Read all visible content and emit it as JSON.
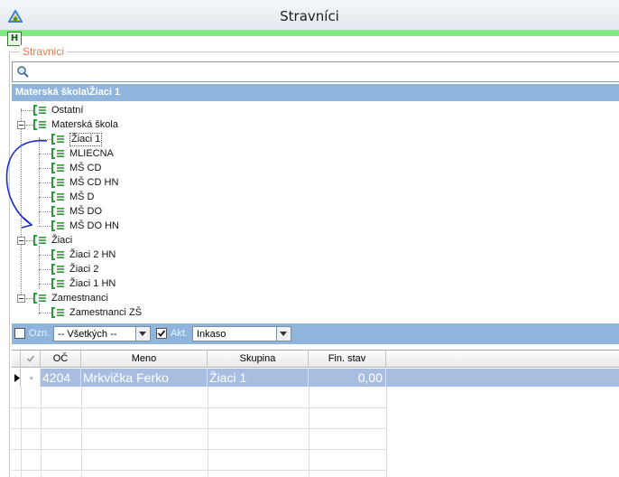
{
  "window": {
    "title": "Stravníci"
  },
  "toolbar": {
    "h_label": "H"
  },
  "group": {
    "label": "Stravnici"
  },
  "path": "Materská škola\\Žiaci 1",
  "tree": [
    {
      "label": "Ostatní"
    },
    {
      "label": "Materská škola"
    },
    {
      "label": "Žiaci 1"
    },
    {
      "label": "MLIECNA"
    },
    {
      "label": "MŠ CD"
    },
    {
      "label": "MŠ CD HN"
    },
    {
      "label": "MŠ D"
    },
    {
      "label": "MŠ DO"
    },
    {
      "label": "MŠ DO HN"
    },
    {
      "label": "Žiaci"
    },
    {
      "label": "Žiaci 2 HN"
    },
    {
      "label": "Žiaci 2"
    },
    {
      "label": "Žiaci 1 HN"
    },
    {
      "label": "Zamestnanci"
    },
    {
      "label": "Zamestnanci ZŠ"
    }
  ],
  "filter": {
    "ozn_label": "Ozn.",
    "combo1_value": "-- Všetkých --",
    "akt_label": "Akt.",
    "combo2_value": "Inkaso"
  },
  "grid": {
    "headers": [
      "OČ",
      "Meno",
      "Skupina",
      "Fin. stav"
    ],
    "rows": [
      {
        "oc": "4204",
        "meno": "Mrkvička Ferko",
        "skupina": "Žiaci 1",
        "fin": "0,00"
      }
    ]
  },
  "colors": {
    "accent": "#8fb5dc",
    "green_bar": "#82e882",
    "group_label": "#e8794a",
    "selected_row": "#a9bde0"
  }
}
